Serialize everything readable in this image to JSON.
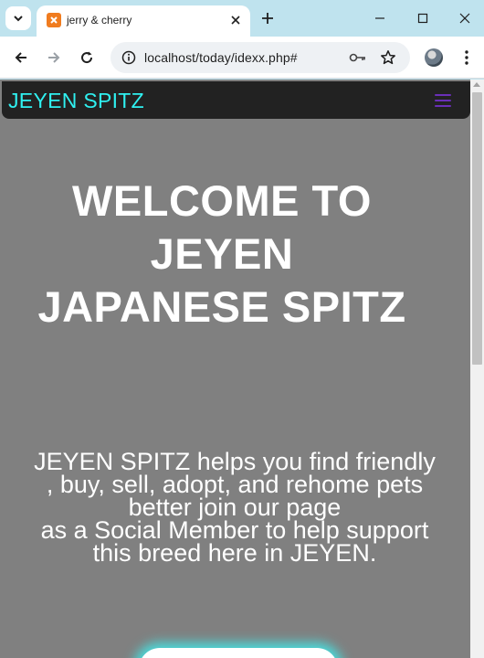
{
  "browser": {
    "tab": {
      "title": "jerry & cherry"
    },
    "address_bar": {
      "url": "localhost/today/idexx.php#"
    },
    "icons": [
      "tab-search-icon",
      "xampp-favicon-icon",
      "close-icon",
      "plus-icon",
      "minimize-icon",
      "maximize-icon",
      "close-window-icon",
      "back-arrow-icon",
      "forward-arrow-icon",
      "reload-icon",
      "site-info-icon",
      "password-key-icon",
      "bookmark-star-icon",
      "profile-avatar",
      "more-menu-icon"
    ]
  },
  "site": {
    "brand": "JEYEN SPITZ",
    "menu_icon": "hamburger-menu-icon",
    "hero": {
      "title": "WELCOME TO JEYEN JAPANESE SPITZ",
      "description_line1": "JEYEN SPITZ helps you find friendly , buy, sell, adopt, and rehome pets better join our page",
      "description_line2": "as a Social Member to help support this breed here in JEYEN."
    }
  },
  "colors": {
    "brand_text": "#2ff0f0",
    "nav_background": "#222222",
    "page_background": "#808080",
    "hamburger": "#6a2fb8",
    "button_glow": "#40ebeb"
  }
}
